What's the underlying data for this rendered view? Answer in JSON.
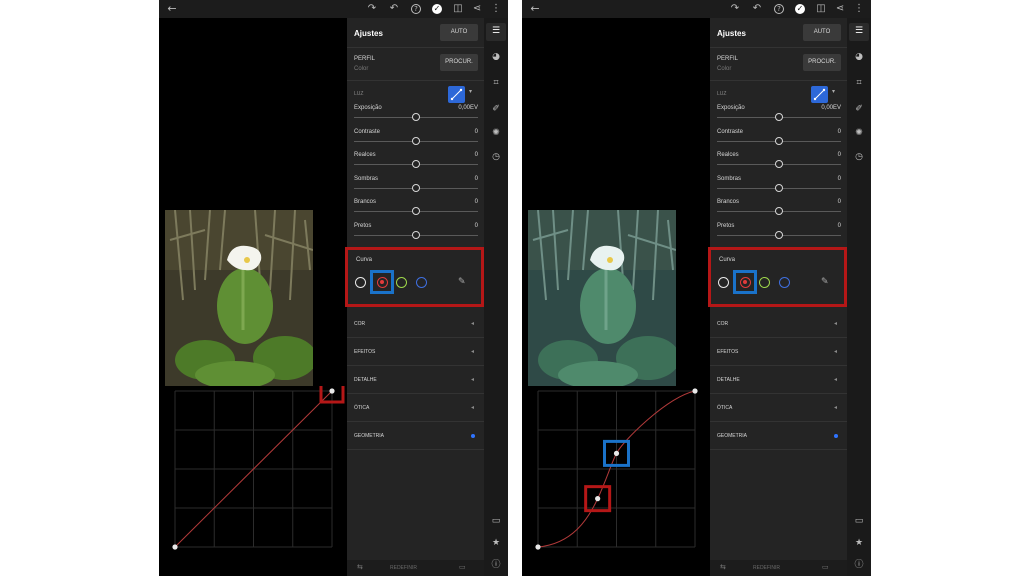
{
  "panels": [
    {
      "id": "before",
      "toolbar": {
        "back": "←",
        "redo": "↷",
        "undo": "↶",
        "help": "?",
        "check": "✓",
        "compare": "◫",
        "share": "⋖",
        "more": "⋮"
      },
      "adjust": {
        "title": "Ajustes",
        "auto_label": "AUTO",
        "profile_label": "PERFIL",
        "profile_value": "Color",
        "browse_label": "PROCUR.",
        "light_label": "LUZ",
        "sliders": [
          {
            "label": "Exposição",
            "value": "0,00EV",
            "position": 0.5
          },
          {
            "label": "Contraste",
            "value": "0",
            "position": 0.5
          },
          {
            "label": "Realces",
            "value": "0",
            "position": 0.5
          },
          {
            "label": "Sombras",
            "value": "0",
            "position": 0.5
          },
          {
            "label": "Brancos",
            "value": "0",
            "position": 0.5
          },
          {
            "label": "Pretos",
            "value": "0",
            "position": 0.5
          }
        ],
        "curve_title": "Curva",
        "sections": [
          "COR",
          "EFEITOS",
          "DETALHE",
          "ÓTICA",
          "GEOMETRIA"
        ],
        "reset_label": "REDEFINIR"
      },
      "curve": {
        "shape": "linear",
        "points": [
          [
            0,
            0
          ],
          [
            1,
            1
          ]
        ]
      }
    },
    {
      "id": "after",
      "toolbar": {
        "back": "←",
        "redo": "↷",
        "undo": "↶",
        "help": "?",
        "check": "✓",
        "compare": "◫",
        "share": "⋖",
        "more": "⋮"
      },
      "adjust": {
        "title": "Ajustes",
        "auto_label": "AUTO",
        "profile_label": "PERFIL",
        "profile_value": "Color",
        "browse_label": "PROCUR.",
        "light_label": "LUZ",
        "sliders": [
          {
            "label": "Exposição",
            "value": "0,00EV",
            "position": 0.5
          },
          {
            "label": "Contraste",
            "value": "0",
            "position": 0.5
          },
          {
            "label": "Realces",
            "value": "0",
            "position": 0.5
          },
          {
            "label": "Sombras",
            "value": "0",
            "position": 0.5
          },
          {
            "label": "Brancos",
            "value": "0",
            "position": 0.5
          },
          {
            "label": "Pretos",
            "value": "0",
            "position": 0.5
          }
        ],
        "curve_title": "Curva",
        "sections": [
          "COR",
          "EFEITOS",
          "DETALHE",
          "ÓTICA",
          "GEOMETRIA"
        ],
        "reset_label": "REDEFINIR"
      },
      "curve": {
        "shape": "s-curve",
        "points": [
          [
            0,
            0
          ],
          [
            0.38,
            0.31
          ],
          [
            0.5,
            0.6
          ],
          [
            1,
            1
          ]
        ]
      }
    }
  ],
  "colors": {
    "accent_blue": "#2d68d8",
    "highlight_red": "#b51717",
    "highlight_blue": "#1a72c9",
    "red_channel": "#e23b3b",
    "green_channel": "#9fd84a",
    "blue_channel": "#3f6fe0"
  },
  "icons": [
    "back-arrow-icon",
    "redo-icon",
    "undo-icon",
    "help-icon",
    "check-icon",
    "compare-icon",
    "share-icon",
    "more-icon",
    "sliders-icon",
    "color-mix-icon",
    "crop-icon",
    "brush-icon",
    "healing-icon",
    "history-icon",
    "comment-icon",
    "star-icon",
    "info-icon"
  ]
}
